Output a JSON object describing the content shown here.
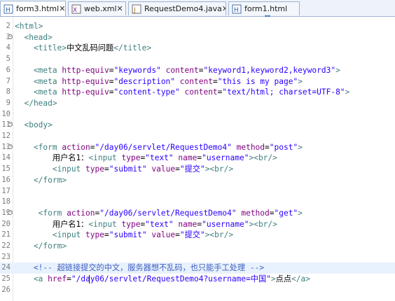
{
  "tabs": [
    {
      "label": "form3.html",
      "active": true,
      "icon": "html-file-icon",
      "closable": true
    },
    {
      "label": "web.xml",
      "active": false,
      "icon": "xml-file-icon",
      "closable": true
    },
    {
      "label": "RequestDemo4.java",
      "active": false,
      "icon": "java-file-icon",
      "closable": true
    },
    {
      "label": "form1.html",
      "active": false,
      "icon": "html-file-icon",
      "closable": false
    }
  ],
  "views_indicator": "▾▾",
  "lines": [
    {
      "n": "2",
      "fold": "",
      "parts": [
        {
          "c": "t",
          "s": "<html>"
        }
      ]
    },
    {
      "n": "3",
      "fold": "⊖",
      "parts": [
        {
          "c": "t",
          "s": "  <head>"
        }
      ]
    },
    {
      "n": "4",
      "fold": "",
      "parts": [
        {
          "c": "t",
          "s": "    <title>"
        },
        {
          "c": "x",
          "s": "中文乱码问题"
        },
        {
          "c": "t",
          "s": "</title>"
        }
      ]
    },
    {
      "n": "5",
      "fold": "",
      "parts": []
    },
    {
      "n": "6",
      "fold": "",
      "parts": [
        {
          "c": "t",
          "s": "    <meta "
        },
        {
          "c": "a",
          "s": "http-equiv"
        },
        {
          "c": "x",
          "s": "="
        },
        {
          "c": "v",
          "s": "\"keywords\""
        },
        {
          "c": "x",
          "s": " "
        },
        {
          "c": "a",
          "s": "content"
        },
        {
          "c": "x",
          "s": "="
        },
        {
          "c": "v",
          "s": "\"keyword1,keyword2,keyword3\""
        },
        {
          "c": "t",
          "s": ">"
        }
      ]
    },
    {
      "n": "7",
      "fold": "",
      "parts": [
        {
          "c": "t",
          "s": "    <meta "
        },
        {
          "c": "a",
          "s": "http-equiv"
        },
        {
          "c": "x",
          "s": "="
        },
        {
          "c": "v",
          "s": "\"description\""
        },
        {
          "c": "x",
          "s": " "
        },
        {
          "c": "a",
          "s": "content"
        },
        {
          "c": "x",
          "s": "="
        },
        {
          "c": "v",
          "s": "\"this is my page\""
        },
        {
          "c": "t",
          "s": ">"
        }
      ]
    },
    {
      "n": "8",
      "fold": "",
      "parts": [
        {
          "c": "t",
          "s": "    <meta "
        },
        {
          "c": "a",
          "s": "http-equiv"
        },
        {
          "c": "x",
          "s": "="
        },
        {
          "c": "v",
          "s": "\"content-type\""
        },
        {
          "c": "x",
          "s": " "
        },
        {
          "c": "a",
          "s": "content"
        },
        {
          "c": "x",
          "s": "="
        },
        {
          "c": "v",
          "s": "\"text/html; charset=UTF-8\""
        },
        {
          "c": "t",
          "s": ">"
        }
      ]
    },
    {
      "n": "9",
      "fold": "",
      "parts": [
        {
          "c": "t",
          "s": "  </head>"
        }
      ]
    },
    {
      "n": "10",
      "fold": "",
      "parts": []
    },
    {
      "n": "11",
      "fold": "⊖",
      "parts": [
        {
          "c": "t",
          "s": "  <body>"
        }
      ]
    },
    {
      "n": "12",
      "fold": "",
      "parts": []
    },
    {
      "n": "13",
      "fold": "⊖",
      "parts": [
        {
          "c": "t",
          "s": "    <form "
        },
        {
          "c": "a",
          "s": "action"
        },
        {
          "c": "x",
          "s": "="
        },
        {
          "c": "v",
          "s": "\"/day06/servlet/RequestDemo4\""
        },
        {
          "c": "x",
          "s": " "
        },
        {
          "c": "a",
          "s": "method"
        },
        {
          "c": "x",
          "s": "="
        },
        {
          "c": "v",
          "s": "\"post\""
        },
        {
          "c": "t",
          "s": ">"
        }
      ]
    },
    {
      "n": "14",
      "fold": "",
      "parts": [
        {
          "c": "x",
          "s": "        用户名1："
        },
        {
          "c": "t",
          "s": "<input "
        },
        {
          "c": "a",
          "s": "type"
        },
        {
          "c": "x",
          "s": "="
        },
        {
          "c": "v",
          "s": "\"text\""
        },
        {
          "c": "x",
          "s": " "
        },
        {
          "c": "a",
          "s": "name"
        },
        {
          "c": "x",
          "s": "="
        },
        {
          "c": "v",
          "s": "\"username\""
        },
        {
          "c": "t",
          "s": "><br/>"
        }
      ]
    },
    {
      "n": "15",
      "fold": "",
      "parts": [
        {
          "c": "t",
          "s": "        <input "
        },
        {
          "c": "a",
          "s": "type"
        },
        {
          "c": "x",
          "s": "="
        },
        {
          "c": "v",
          "s": "\"submit\""
        },
        {
          "c": "x",
          "s": " "
        },
        {
          "c": "a",
          "s": "value"
        },
        {
          "c": "x",
          "s": "="
        },
        {
          "c": "v",
          "s": "\"提交\""
        },
        {
          "c": "t",
          "s": "><br/>"
        }
      ]
    },
    {
      "n": "16",
      "fold": "",
      "parts": [
        {
          "c": "t",
          "s": "    </form>"
        }
      ]
    },
    {
      "n": "17",
      "fold": "",
      "parts": []
    },
    {
      "n": "18",
      "fold": "",
      "parts": []
    },
    {
      "n": "19",
      "fold": "⊖",
      "parts": [
        {
          "c": "t",
          "s": "     <form "
        },
        {
          "c": "a",
          "s": "action"
        },
        {
          "c": "x",
          "s": "="
        },
        {
          "c": "v",
          "s": "\"/day06/servlet/RequestDemo4\""
        },
        {
          "c": "x",
          "s": " "
        },
        {
          "c": "a",
          "s": "method"
        },
        {
          "c": "x",
          "s": "="
        },
        {
          "c": "v",
          "s": "\"get\""
        },
        {
          "c": "t",
          "s": ">"
        }
      ]
    },
    {
      "n": "20",
      "fold": "",
      "parts": [
        {
          "c": "x",
          "s": "        用户名1："
        },
        {
          "c": "t",
          "s": "<input "
        },
        {
          "c": "a",
          "s": "type"
        },
        {
          "c": "x",
          "s": "="
        },
        {
          "c": "v",
          "s": "\"text\""
        },
        {
          "c": "x",
          "s": " "
        },
        {
          "c": "a",
          "s": "name"
        },
        {
          "c": "x",
          "s": "="
        },
        {
          "c": "v",
          "s": "\"username\""
        },
        {
          "c": "t",
          "s": "><br/>"
        }
      ]
    },
    {
      "n": "21",
      "fold": "",
      "parts": [
        {
          "c": "t",
          "s": "        <input "
        },
        {
          "c": "a",
          "s": "type"
        },
        {
          "c": "x",
          "s": "="
        },
        {
          "c": "v",
          "s": "\"submit\""
        },
        {
          "c": "x",
          "s": " "
        },
        {
          "c": "a",
          "s": "value"
        },
        {
          "c": "x",
          "s": "="
        },
        {
          "c": "v",
          "s": "\"提交\""
        },
        {
          "c": "t",
          "s": "><br/>"
        }
      ]
    },
    {
      "n": "22",
      "fold": "",
      "parts": [
        {
          "c": "t",
          "s": "    </form>"
        }
      ]
    },
    {
      "n": "23",
      "fold": "",
      "parts": []
    },
    {
      "n": "24",
      "fold": "",
      "current": true,
      "parts": [
        {
          "c": "c",
          "s": "    <!-- 超链接提交的中文，服务器想不乱码，也只能手工处理 -->"
        }
      ]
    },
    {
      "n": "25",
      "fold": "",
      "parts": [
        {
          "c": "t",
          "s": "    <a "
        },
        {
          "c": "a",
          "s": "href"
        },
        {
          "c": "x",
          "s": "="
        },
        {
          "c": "v",
          "s": "\"/day06/servlet/RequestDemo4?username=中国\""
        },
        {
          "c": "t",
          "s": ">"
        },
        {
          "c": "x",
          "s": "点点"
        },
        {
          "c": "t",
          "s": "</a>"
        }
      ]
    },
    {
      "n": "26",
      "fold": "",
      "parts": []
    }
  ]
}
